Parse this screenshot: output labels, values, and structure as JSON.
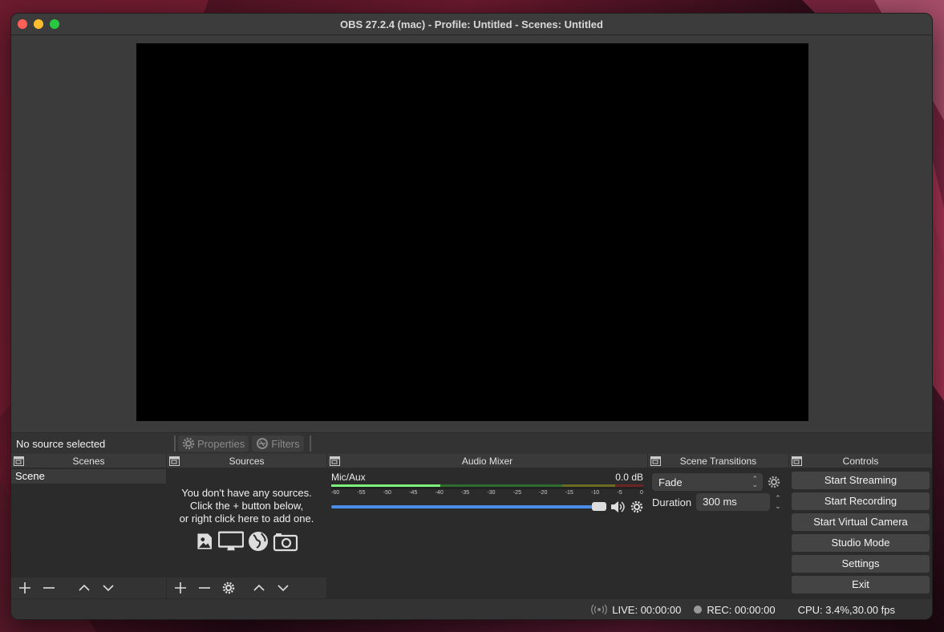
{
  "window": {
    "title": "OBS 27.2.4 (mac) - Profile: Untitled - Scenes: Untitled"
  },
  "source_toolbar": {
    "selection": "No source selected",
    "properties_label": "Properties",
    "filters_label": "Filters"
  },
  "scenes": {
    "header": "Scenes",
    "items": [
      "Scene"
    ]
  },
  "sources": {
    "header": "Sources",
    "empty_line1": "You don't have any sources.",
    "empty_line2": "Click the + button below,",
    "empty_line3": "or right click here to add one."
  },
  "audio_mixer": {
    "header": "Audio Mixer",
    "channel_name": "Mic/Aux",
    "channel_db": "0.0 dB",
    "ticks": [
      "-60",
      "-55",
      "-50",
      "-45",
      "-40",
      "-35",
      "-30",
      "-25",
      "-20",
      "-15",
      "-10",
      "-5",
      "0"
    ],
    "volume_fraction": 1.0
  },
  "transitions": {
    "header": "Scene Transitions",
    "selected": "Fade",
    "duration_label": "Duration",
    "duration_value": "300 ms"
  },
  "controls": {
    "header": "Controls",
    "start_streaming": "Start Streaming",
    "start_recording": "Start Recording",
    "start_virtual_camera": "Start Virtual Camera",
    "studio_mode": "Studio Mode",
    "settings": "Settings",
    "exit": "Exit"
  },
  "status": {
    "live": "LIVE: 00:00:00",
    "rec": "REC: 00:00:00",
    "cpu": "CPU: 3.4%,30.00 fps"
  },
  "colors": {
    "accent": "#4a8ee8",
    "close": "#ff5f57",
    "minimize": "#febc2e",
    "maximize": "#28c840"
  }
}
